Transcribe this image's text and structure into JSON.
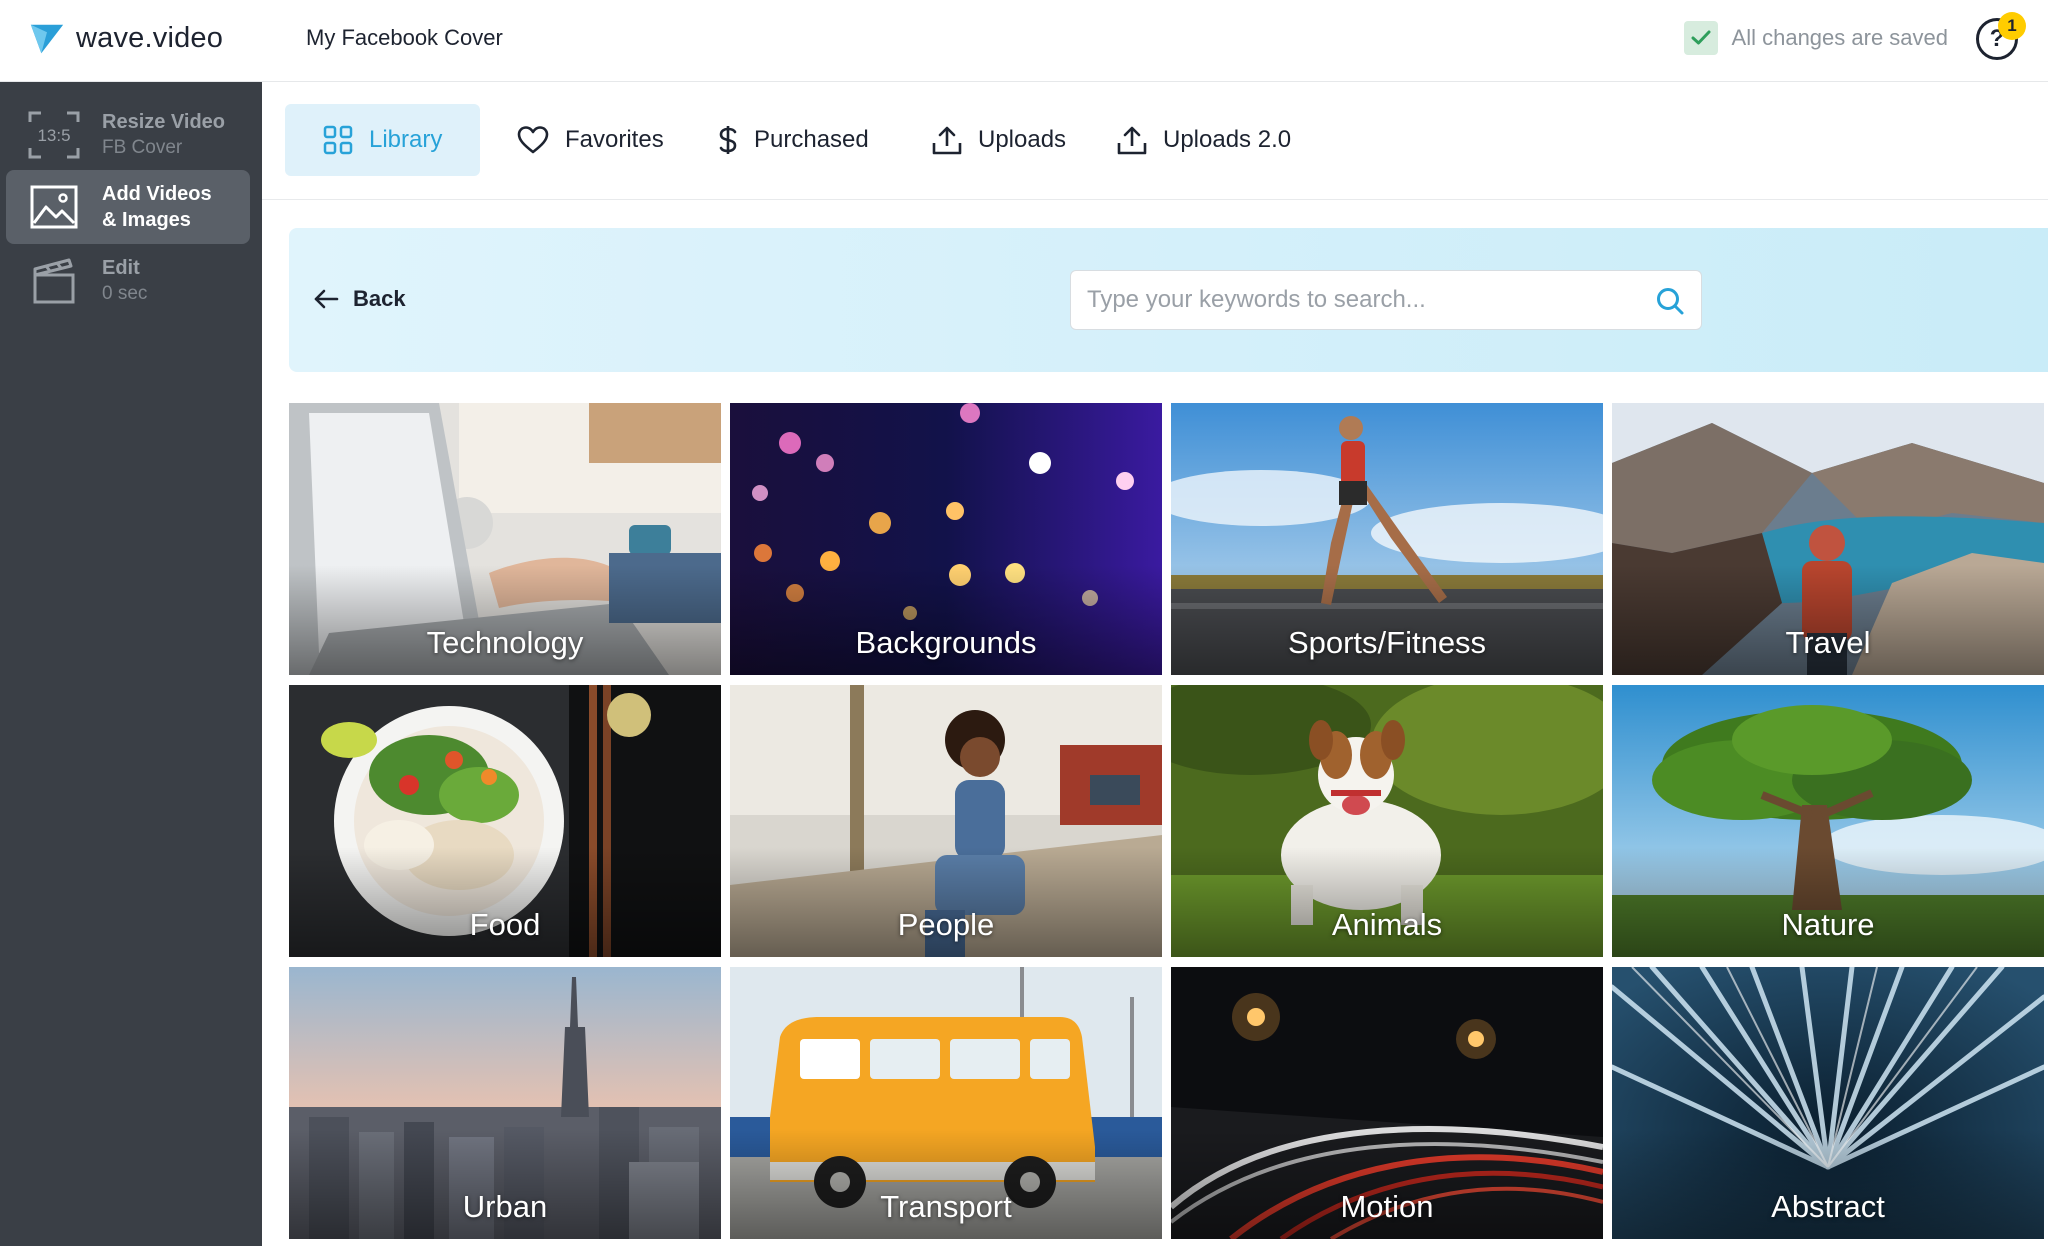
{
  "app": {
    "logo_text": "wave.video",
    "project_name": "My Facebook Cover",
    "save_status": "All changes are saved",
    "help_icon": "?",
    "notification_count": "1"
  },
  "sidebar": {
    "steps": [
      {
        "badge": "13:5",
        "title": "Resize Video",
        "subtitle": "FB Cover",
        "icon": "resize-frame-icon"
      },
      {
        "title": "Add Videos & Images",
        "title_line1": "Add Videos",
        "title_line2": "& Images",
        "icon": "image-icon"
      },
      {
        "title": "Edit",
        "subtitle": "0 sec",
        "icon": "clapperboard-icon"
      }
    ]
  },
  "tabs": [
    {
      "label": "Library",
      "icon": "grid-icon",
      "active": true
    },
    {
      "label": "Favorites",
      "icon": "heart-icon"
    },
    {
      "label": "Purchased",
      "icon": "dollar-icon"
    },
    {
      "label": "Uploads",
      "icon": "upload-icon"
    },
    {
      "label": "Uploads 2.0",
      "icon": "upload-icon"
    }
  ],
  "search": {
    "back_label": "Back",
    "placeholder": "Type your keywords to search..."
  },
  "categories": [
    "Technology",
    "Backgrounds",
    "Sports/Fitness",
    "Travel",
    "Food",
    "People",
    "Animals",
    "Nature",
    "Urban",
    "Transport",
    "Motion",
    "Abstract"
  ],
  "colors": {
    "accent": "#27a2d8",
    "sidebar": "#3a3f46",
    "sidebar_active": "#5a6068",
    "banner": "#d3effa",
    "saved_check": "#2e9e5b",
    "badge": "#ffcc00"
  }
}
